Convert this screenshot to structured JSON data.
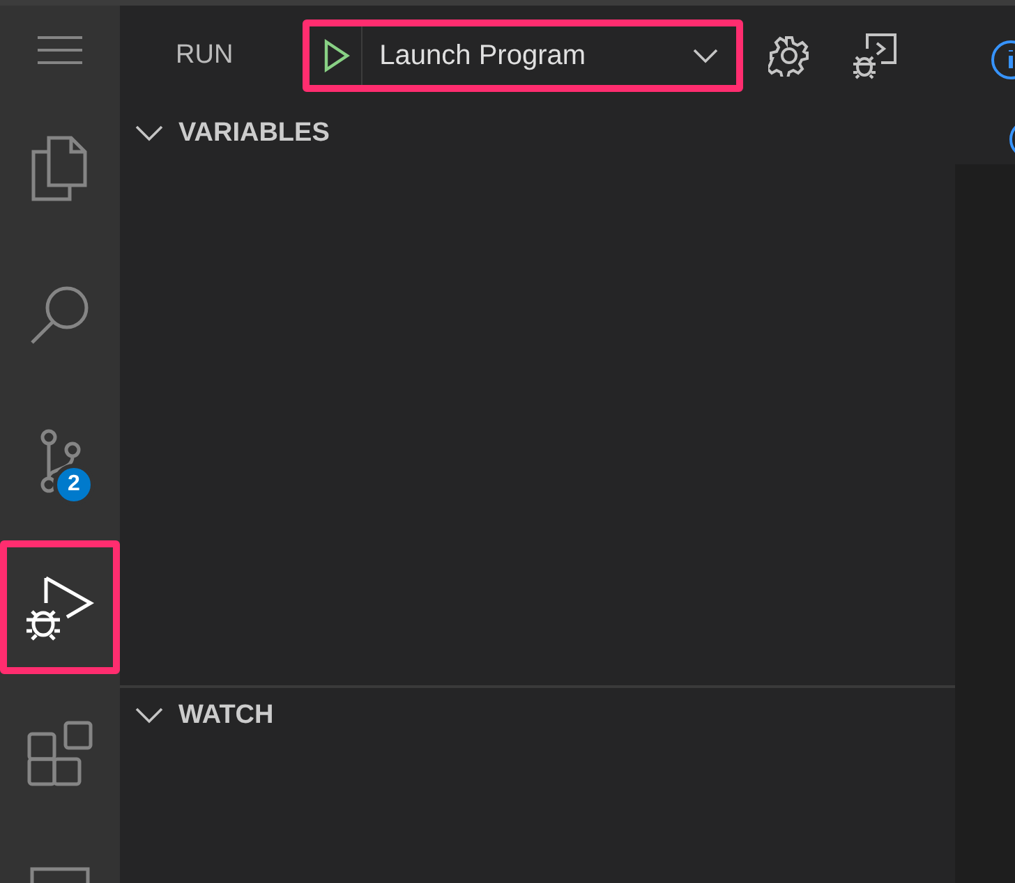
{
  "activity_bar": {
    "items": [
      {
        "kind": "menu",
        "selected": false,
        "highlighted": false
      },
      {
        "kind": "files",
        "selected": false,
        "highlighted": false
      },
      {
        "kind": "search",
        "selected": false,
        "highlighted": false
      },
      {
        "kind": "source-control",
        "selected": false,
        "highlighted": false,
        "badge": "2"
      },
      {
        "kind": "run",
        "selected": true,
        "highlighted": true
      },
      {
        "kind": "extensions",
        "selected": false,
        "highlighted": false
      },
      {
        "kind": "panel",
        "selected": false,
        "highlighted": false
      }
    ]
  },
  "sidebar": {
    "title": "RUN",
    "launch": {
      "configuration": "Launch Program",
      "highlighted": true
    },
    "sections": [
      {
        "title": "VARIABLES",
        "expanded": true
      },
      {
        "title": "WATCH",
        "expanded": true
      }
    ]
  }
}
